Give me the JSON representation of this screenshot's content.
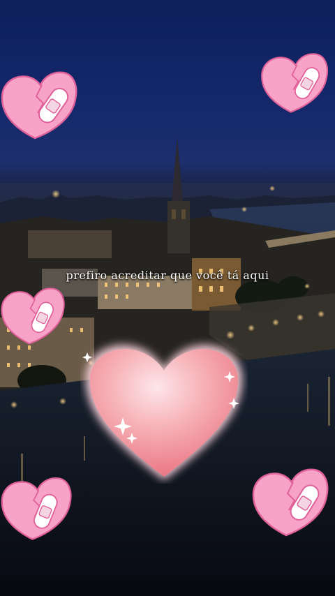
{
  "caption": "prefiro acreditar que você tá aqui",
  "stickers": {
    "small_heart_icon": "bandaged-heart-icon",
    "big_heart_icon": "glowing-heart-icon",
    "colors": {
      "heart_pink": "#f7a3c7",
      "heart_outline": "#e0609a",
      "bandage": "#ffffff",
      "glow_heart": "#f48a96"
    }
  },
  "scene": {
    "subject": "night-city-aerial",
    "sky": "#14286b",
    "lights": "#ffcf7a"
  }
}
